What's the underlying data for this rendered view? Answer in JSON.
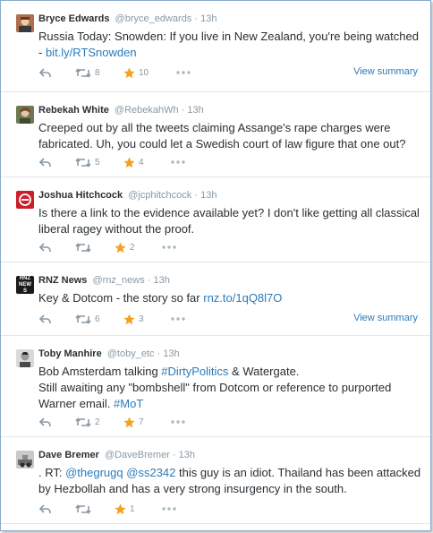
{
  "tweets": [
    {
      "name": "Bryce Edwards",
      "handle": "@bryce_edwards",
      "sep": "·",
      "time": "13h",
      "text": "Russia Today: Snowden: If you live in New Zealand, you're being watched - ",
      "link": "bit.ly/RTSnowden",
      "retweets": "8",
      "favorites": "10",
      "summary": "View summary"
    },
    {
      "name": "Rebekah White",
      "handle": "@RebekahWh",
      "sep": "·",
      "time": "13h",
      "text": "Creeped out by all the tweets claiming Assange's rape charges were fabricated. Uh, you could let a Swedish court of law figure that one out?",
      "retweets": "5",
      "favorites": "4"
    },
    {
      "name": "Joshua Hitchcock",
      "handle": "@jcphitchcock",
      "sep": "·",
      "time": "13h",
      "text": "Is there a link to the evidence available yet? I don't like getting all classical liberal ragey without the proof.",
      "retweets": "",
      "favorites": "2"
    },
    {
      "name": "RNZ News",
      "handle": "@rnz_news",
      "sep": "·",
      "time": "13h",
      "text": "Key & Dotcom - the story so far ",
      "link": "rnz.to/1qQ8l7O",
      "retweets": "6",
      "favorites": "3",
      "summary": "View summary",
      "avatar_text": "RNZ NEWS"
    },
    {
      "name": "Toby Manhire",
      "handle": "@toby_etc",
      "sep": "·",
      "time": "13h",
      "line1_pre": "Bob Amsterdam talking ",
      "line1_tag": "#DirtyPolitics",
      "line1_post": " & Watergate.",
      "line2": "Still awaiting any \"bombshell\" from Dotcom or reference to purported",
      "line3_pre": "Warner email. ",
      "line3_tag": "#MoT",
      "retweets": "2",
      "favorites": "7"
    },
    {
      "name": "Dave Bremer",
      "handle": "@DaveBremer",
      "sep": "·",
      "time": "13h",
      "pre": ". RT: ",
      "mention1": "@thegrugq",
      "mention2": "@ss2342",
      "rest1": " this guy is an idiot. Thailand has been attacked",
      "line2": "by Hezbollah and has a very strong insurgency in the south.",
      "retweets": "",
      "favorites": "1"
    }
  ],
  "colors": {
    "link": "#2b7bb9",
    "star": "#f4a020",
    "muted": "#8899a6",
    "divider": "#e1e8ed"
  },
  "icons": [
    "reply-icon",
    "retweet-icon",
    "favorite-star-icon",
    "more-dots-icon"
  ]
}
